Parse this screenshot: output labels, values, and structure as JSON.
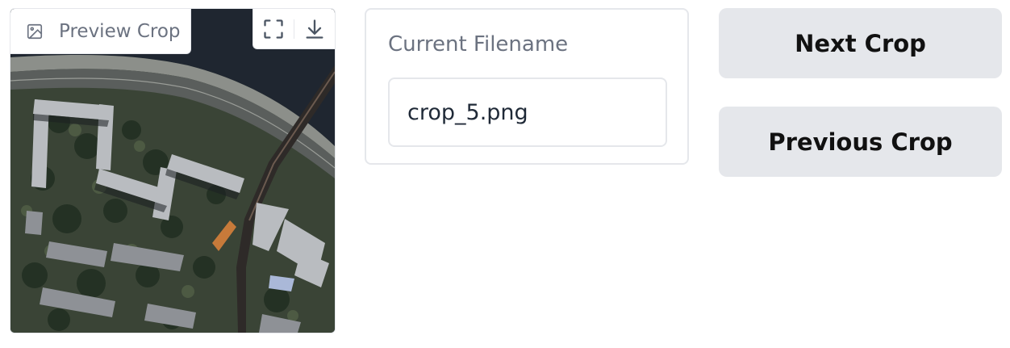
{
  "image_panel": {
    "label": "Preview Crop",
    "label_icon": "image-icon",
    "actions": [
      "fullscreen-icon",
      "download-icon"
    ]
  },
  "filename_panel": {
    "label": "Current Filename",
    "value": "crop_5.png"
  },
  "buttons": {
    "next_label": "Next Crop",
    "previous_label": "Previous Crop"
  },
  "colors": {
    "button_bg": "#e5e7eb",
    "border": "#e5e7eb",
    "label_text": "#6b7280",
    "water": "#1e2530"
  }
}
